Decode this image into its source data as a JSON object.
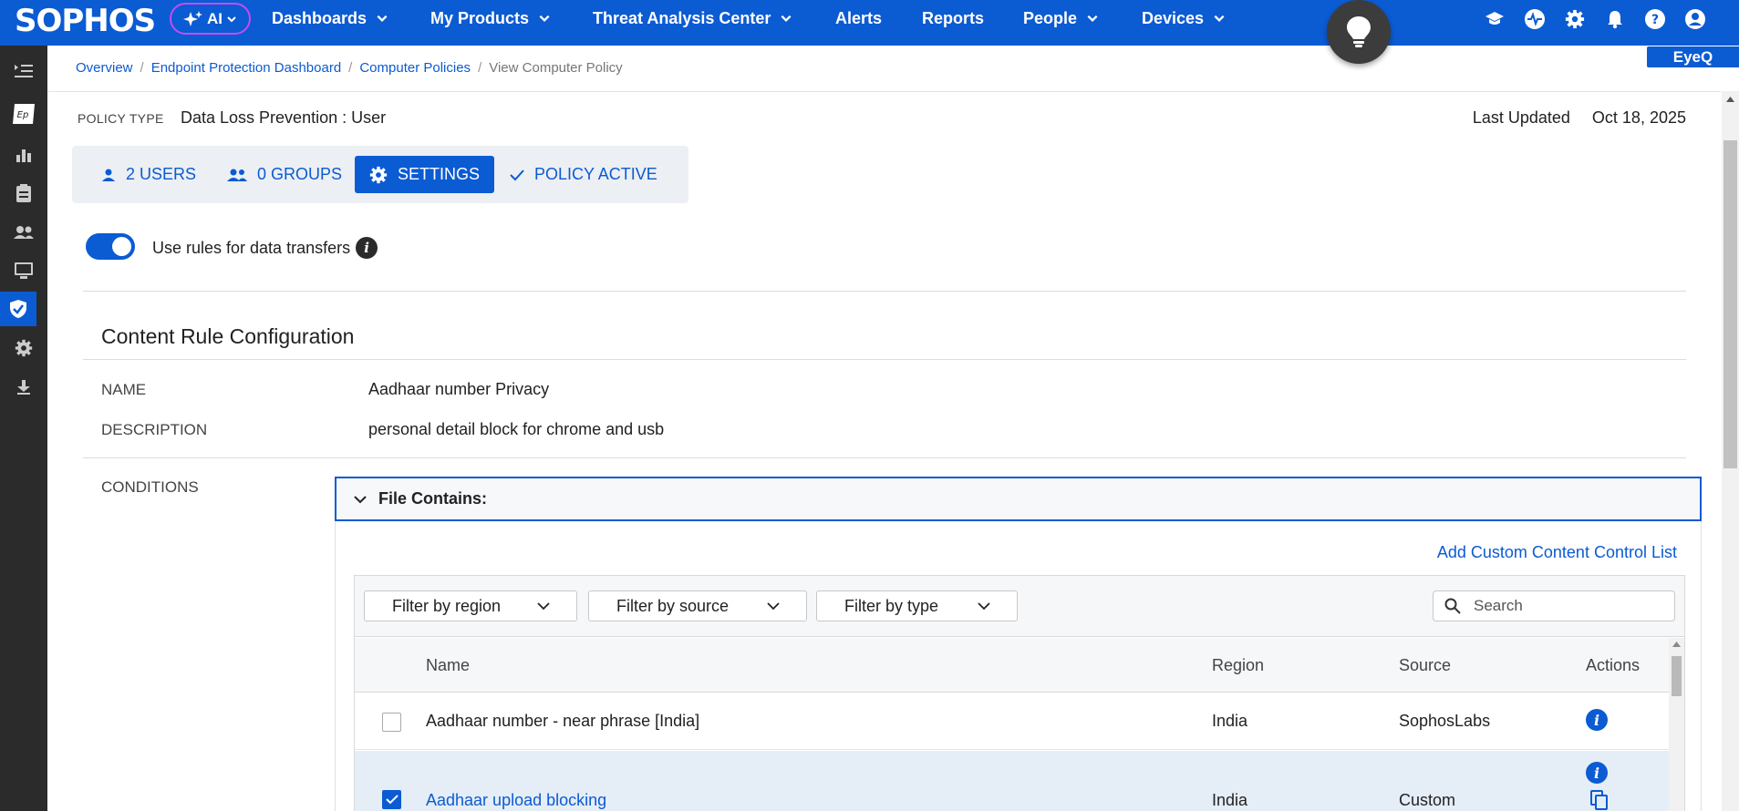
{
  "header": {
    "logo": "SOPHOS",
    "ai_label": "AI",
    "nav": [
      {
        "label": "Dashboards"
      },
      {
        "label": "My Products"
      },
      {
        "label": "Threat Analysis Center"
      },
      {
        "label": "Alerts"
      },
      {
        "label": "Reports"
      },
      {
        "label": "People"
      },
      {
        "label": "Devices"
      }
    ],
    "icons": [
      "graduation-cap-icon",
      "pulse-icon",
      "gear-icon",
      "bell-icon",
      "help-icon",
      "user-icon"
    ],
    "eyeq_label": "EyeQ"
  },
  "breadcrumb": {
    "items": [
      "Overview",
      "Endpoint Protection Dashboard",
      "Computer Policies"
    ],
    "current": "View Computer Policy"
  },
  "policy": {
    "type_label": "POLICY TYPE",
    "type_value": "Data Loss Prevention : User",
    "updated_label": "Last Updated",
    "updated_value": "Oct 18, 2025"
  },
  "tabs": [
    {
      "label": "2 USERS",
      "icon": "user-icon"
    },
    {
      "label": "0 GROUPS",
      "icon": "group-icon"
    },
    {
      "label": "SETTINGS",
      "icon": "gear-icon",
      "active": true
    },
    {
      "label": "POLICY ACTIVE",
      "icon": "check-icon"
    }
  ],
  "toggle": {
    "label": "Use rules for data transfers",
    "on": true
  },
  "config": {
    "title": "Content Rule Configuration",
    "name_label": "NAME",
    "name_value": "Aadhaar number Privacy",
    "description_label": "DESCRIPTION",
    "description_value": "personal detail block for chrome and usb",
    "conditions_label": "CONDITIONS"
  },
  "conditions": {
    "header": "File Contains:",
    "add_link": "Add Custom Content Control List",
    "filters": [
      "Filter by region",
      "Filter by source",
      "Filter by type"
    ],
    "search_placeholder": "Search",
    "columns": {
      "name": "Name",
      "region": "Region",
      "source": "Source",
      "actions": "Actions"
    },
    "rows": [
      {
        "name": "Aadhaar number - near phrase [India]",
        "region": "India",
        "source": "SophosLabs",
        "checked": false
      },
      {
        "name": "Aadhaar upload blocking",
        "region": "India",
        "source": "Custom",
        "checked": true
      }
    ]
  },
  "colors": {
    "brand": "#0b5bd3",
    "sidebar": "#2b2b2b",
    "ai_border": "#c54cf0"
  }
}
